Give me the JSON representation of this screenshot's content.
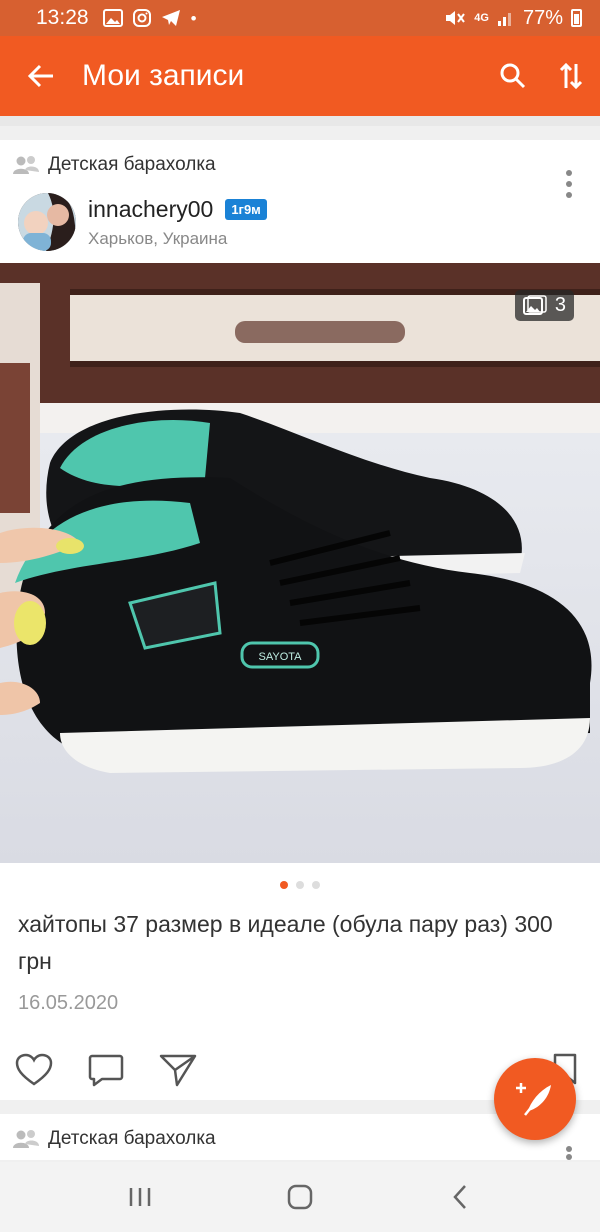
{
  "status_bar": {
    "time": "13:28",
    "network": "4G",
    "battery": "77%",
    "icons": [
      "gallery-icon",
      "instagram-icon",
      "telegram-icon",
      "dot-icon",
      "mute-icon",
      "signal-icon",
      "battery-icon"
    ]
  },
  "app_bar": {
    "title": "Мои записи",
    "back_icon": "arrow-left-icon",
    "search_icon": "search-icon",
    "sort_icon": "sort-icon"
  },
  "posts": [
    {
      "group": "Детская барахолка",
      "author": {
        "name": "innachery00",
        "badge": "1г9м",
        "location": "Харьков, Украина"
      },
      "photo_count": "3",
      "carousel": {
        "total": 3,
        "active": 1
      },
      "text": "хайтопы 37 размер в идеале (обула пару раз) 300 грн",
      "date": "16.05.2020"
    },
    {
      "group": "Детская барахолка"
    }
  ],
  "actions": [
    "like-icon",
    "comment-icon",
    "share-icon",
    "bookmark-icon"
  ],
  "fab": {
    "icon": "add-post-feather-icon"
  },
  "nav_bar": {
    "icons": [
      "recents-icon",
      "home-icon",
      "back-icon"
    ]
  },
  "colors": {
    "accent": "#f15a22",
    "status_bar": "#d76030",
    "badge": "#1a82d6"
  }
}
